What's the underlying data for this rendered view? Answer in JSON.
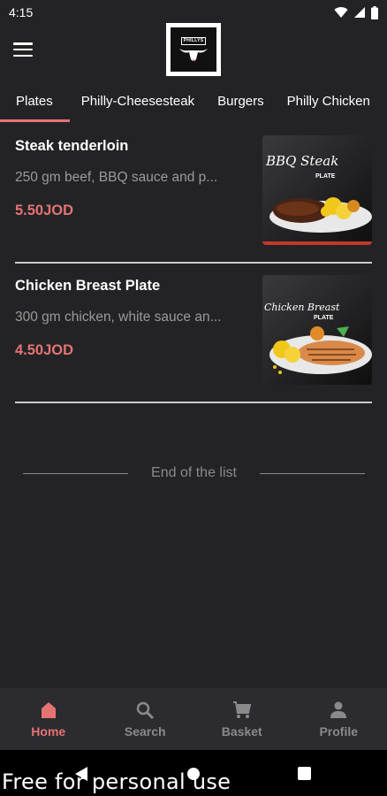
{
  "status_bar": {
    "time": "4:15"
  },
  "logo": {
    "text": "PHILLYS"
  },
  "tabs": [
    {
      "label": "Plates"
    },
    {
      "label": "Philly-Cheesesteak"
    },
    {
      "label": "Burgers"
    },
    {
      "label": "Philly Chicken"
    }
  ],
  "items": [
    {
      "name": "Steak tenderloin",
      "description": "250 gm beef, BBQ sauce and p...",
      "price": "5.50JOD",
      "image_caption": "BBQ Steak",
      "image_sub": "PLATE"
    },
    {
      "name": "Chicken Breast Plate",
      "description": "300 gm chicken, white sauce an...",
      "price": "4.50JOD",
      "image_caption": "Chicken Breast",
      "image_sub": "PLATE"
    }
  ],
  "end_of_list": "End of the list",
  "bottom_nav": [
    {
      "label": "Home",
      "icon": "home-icon"
    },
    {
      "label": "Search",
      "icon": "search-icon"
    },
    {
      "label": "Basket",
      "icon": "cart-icon"
    },
    {
      "label": "Profile",
      "icon": "person-icon"
    }
  ],
  "watermark": "Free for personal use",
  "colors": {
    "accent": "#e57373",
    "background": "#232326",
    "nav_background": "#2c2c30"
  }
}
